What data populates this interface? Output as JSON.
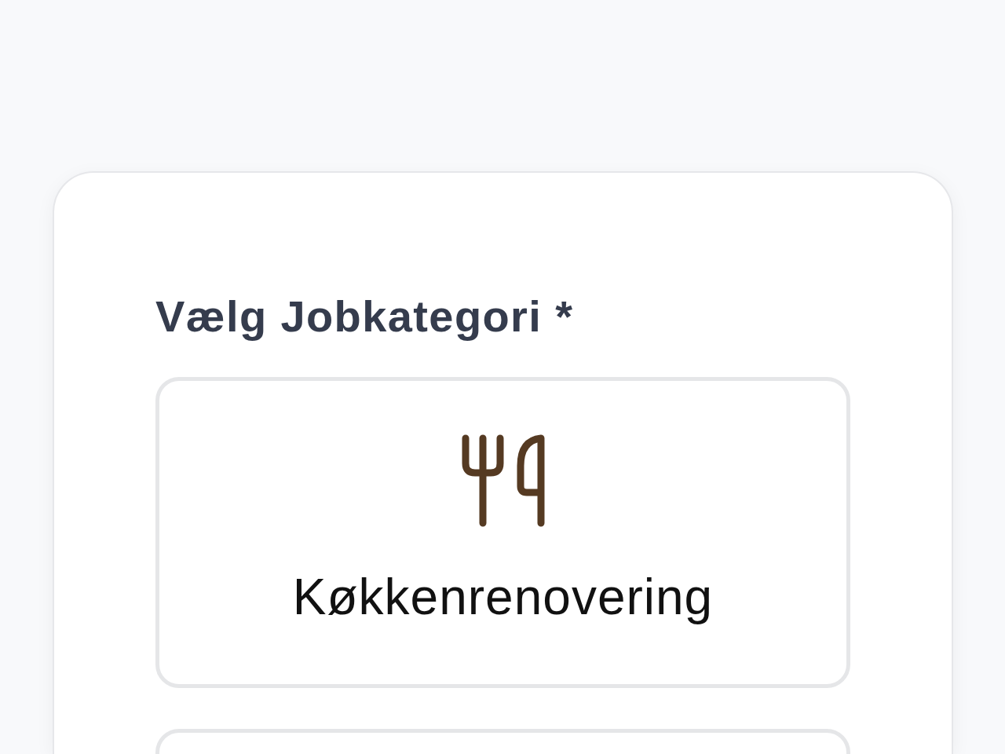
{
  "form": {
    "label": "Vælg Jobkategori *",
    "options": [
      {
        "label": "Køkkenrenovering",
        "selected": false
      },
      {
        "selected": false
      }
    ]
  }
}
